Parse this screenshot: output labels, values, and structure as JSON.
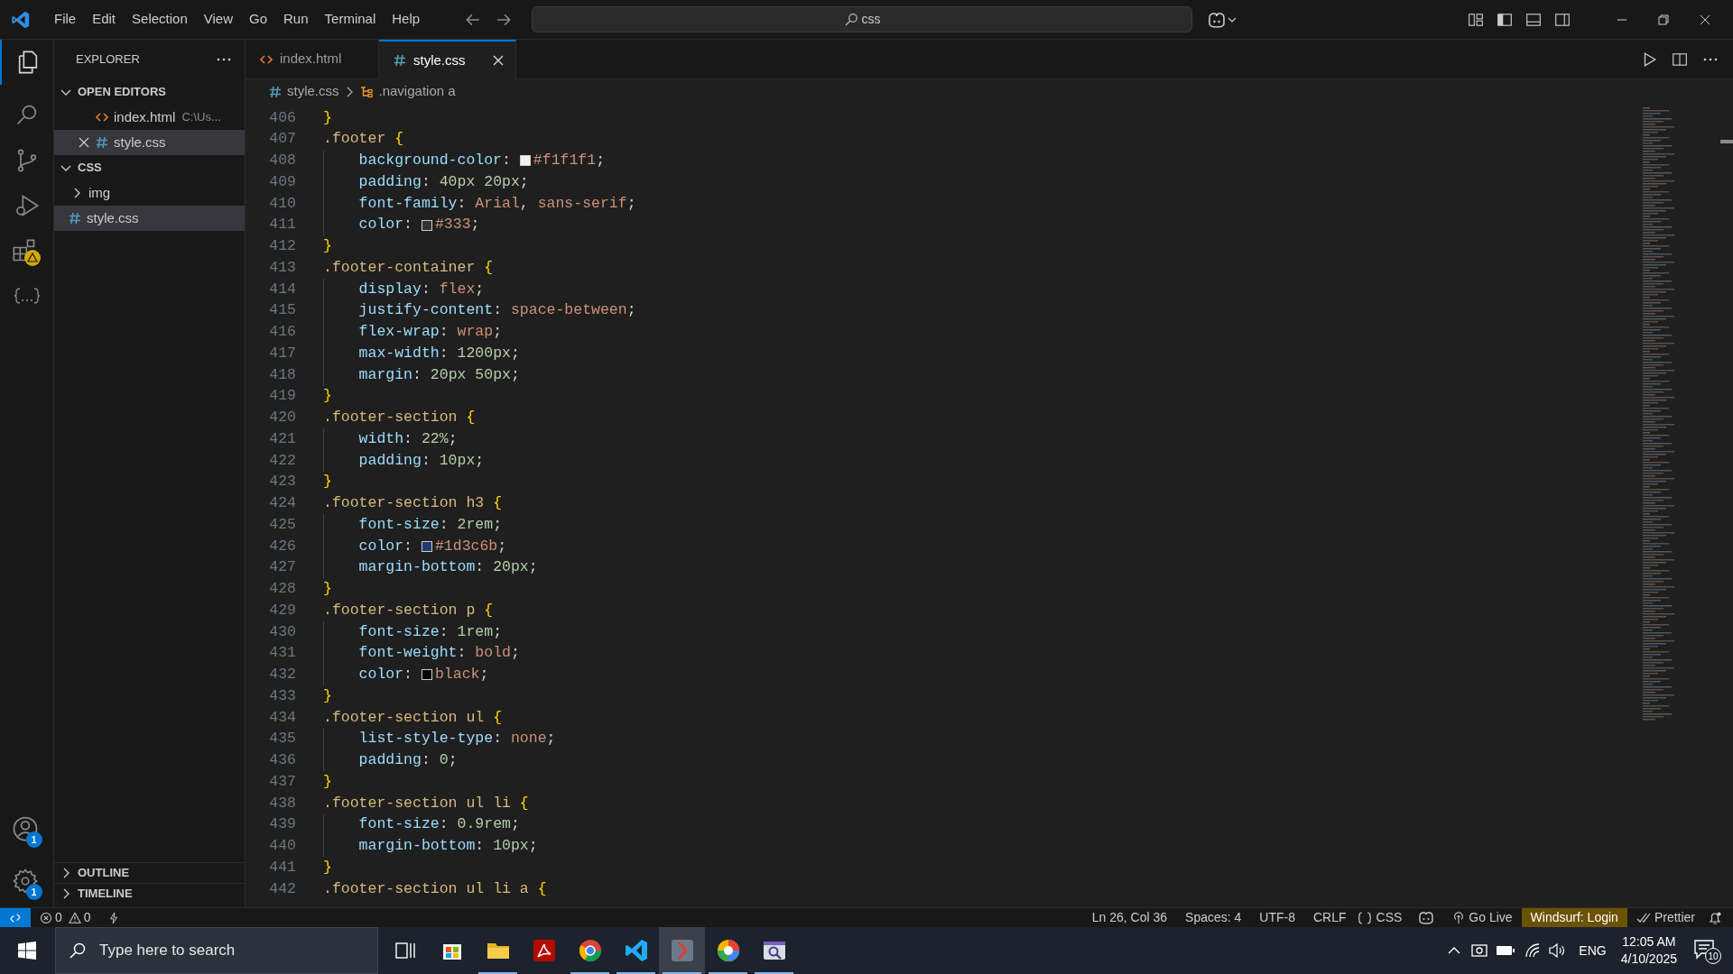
{
  "title_bar": {
    "menu": [
      "File",
      "Edit",
      "Selection",
      "View",
      "Go",
      "Run",
      "Terminal",
      "Help"
    ],
    "search": "css"
  },
  "activity_bar": {
    "account_badge": "1",
    "settings_badge": "1"
  },
  "sidebar": {
    "title": "EXPLORER",
    "sections": [
      {
        "label": "OPEN EDITORS",
        "expanded": true,
        "items": [
          {
            "kind": "html",
            "name": "index.html",
            "path": "C:\\Us...",
            "selected": false,
            "close": false
          },
          {
            "kind": "css",
            "name": "style.css",
            "selected": true,
            "close": true
          }
        ]
      },
      {
        "label": "CSS",
        "expanded": true,
        "items": [
          {
            "kind": "folder",
            "name": "img",
            "expanded": false,
            "selected": false
          },
          {
            "kind": "css",
            "name": "style.css",
            "selected": true
          }
        ]
      }
    ],
    "bottom_sections": [
      {
        "label": "OUTLINE",
        "expanded": false
      },
      {
        "label": "TIMELINE",
        "expanded": false
      }
    ]
  },
  "tabs": [
    {
      "kind": "html",
      "label": "index.html",
      "selected": false
    },
    {
      "kind": "css",
      "label": "style.css",
      "selected": true
    }
  ],
  "breadcrumb": [
    "style.css",
    ".navigation a"
  ],
  "code": {
    "lines": [
      {
        "number": "406",
        "indent": false,
        "tokens": [
          {
            "kind": "brace",
            "text": "}"
          }
        ]
      },
      {
        "number": "407",
        "indent": false,
        "tokens": [
          {
            "kind": "sel",
            "text": ".footer "
          },
          {
            "kind": "brace",
            "text": "{"
          }
        ]
      },
      {
        "number": "408",
        "indent": true,
        "tokens": [
          {
            "kind": "prop",
            "text": "background-color"
          },
          {
            "kind": "punct",
            "text": ": "
          },
          {
            "kind": "swatch",
            "color": "#f1f1f1"
          },
          {
            "kind": "val",
            "text": "#f1f1f1"
          },
          {
            "kind": "punct",
            "text": ";"
          }
        ]
      },
      {
        "number": "409",
        "indent": true,
        "tokens": [
          {
            "kind": "prop",
            "text": "padding"
          },
          {
            "kind": "punct",
            "text": ": "
          },
          {
            "kind": "num",
            "text": "40px 20px"
          },
          {
            "kind": "punct",
            "text": ";"
          }
        ]
      },
      {
        "number": "410",
        "indent": true,
        "tokens": [
          {
            "kind": "prop",
            "text": "font-family"
          },
          {
            "kind": "punct",
            "text": ": "
          },
          {
            "kind": "val",
            "text": "Arial"
          },
          {
            "kind": "punct",
            "text": ", "
          },
          {
            "kind": "val",
            "text": "sans-serif"
          },
          {
            "kind": "punct",
            "text": ";"
          }
        ]
      },
      {
        "number": "411",
        "indent": true,
        "tokens": [
          {
            "kind": "prop",
            "text": "color"
          },
          {
            "kind": "punct",
            "text": ": "
          },
          {
            "kind": "swatch",
            "color": "#333333"
          },
          {
            "kind": "val",
            "text": "#333"
          },
          {
            "kind": "punct",
            "text": ";"
          }
        ]
      },
      {
        "number": "412",
        "indent": false,
        "tokens": [
          {
            "kind": "brace",
            "text": "}"
          }
        ]
      },
      {
        "number": "413",
        "indent": false,
        "tokens": [
          {
            "kind": "sel",
            "text": ".footer-container "
          },
          {
            "kind": "brace",
            "text": "{"
          }
        ]
      },
      {
        "number": "414",
        "indent": true,
        "tokens": [
          {
            "kind": "prop",
            "text": "display"
          },
          {
            "kind": "punct",
            "text": ": "
          },
          {
            "kind": "val",
            "text": "flex"
          },
          {
            "kind": "punct",
            "text": ";"
          }
        ]
      },
      {
        "number": "415",
        "indent": true,
        "tokens": [
          {
            "kind": "prop",
            "text": "justify-content"
          },
          {
            "kind": "punct",
            "text": ": "
          },
          {
            "kind": "val",
            "text": "space-between"
          },
          {
            "kind": "punct",
            "text": ";"
          }
        ]
      },
      {
        "number": "416",
        "indent": true,
        "tokens": [
          {
            "kind": "prop",
            "text": "flex-wrap"
          },
          {
            "kind": "punct",
            "text": ": "
          },
          {
            "kind": "val",
            "text": "wrap"
          },
          {
            "kind": "punct",
            "text": ";"
          }
        ]
      },
      {
        "number": "417",
        "indent": true,
        "tokens": [
          {
            "kind": "prop",
            "text": "max-width"
          },
          {
            "kind": "punct",
            "text": ": "
          },
          {
            "kind": "num",
            "text": "1200"
          },
          {
            "kind": "num",
            "text": "px"
          },
          {
            "kind": "punct",
            "text": ";"
          }
        ]
      },
      {
        "number": "418",
        "indent": true,
        "tokens": [
          {
            "kind": "prop",
            "text": "margin"
          },
          {
            "kind": "punct",
            "text": ": "
          },
          {
            "kind": "num",
            "text": "20px 50px"
          },
          {
            "kind": "punct",
            "text": ";"
          }
        ]
      },
      {
        "number": "419",
        "indent": false,
        "tokens": [
          {
            "kind": "brace",
            "text": "}"
          }
        ]
      },
      {
        "number": "420",
        "indent": false,
        "tokens": [
          {
            "kind": "sel",
            "text": ".footer-section "
          },
          {
            "kind": "brace",
            "text": "{"
          }
        ]
      },
      {
        "number": "421",
        "indent": true,
        "tokens": [
          {
            "kind": "prop",
            "text": "width"
          },
          {
            "kind": "punct",
            "text": ": "
          },
          {
            "kind": "num",
            "text": "22%"
          },
          {
            "kind": "punct",
            "text": ";"
          }
        ]
      },
      {
        "number": "422",
        "indent": true,
        "tokens": [
          {
            "kind": "prop",
            "text": "padding"
          },
          {
            "kind": "punct",
            "text": ": "
          },
          {
            "kind": "num",
            "text": "10"
          },
          {
            "kind": "num",
            "text": "px"
          },
          {
            "kind": "punct",
            "text": ";"
          }
        ]
      },
      {
        "number": "423",
        "indent": false,
        "tokens": [
          {
            "kind": "brace",
            "text": "}"
          }
        ]
      },
      {
        "number": "424",
        "indent": false,
        "tokens": [
          {
            "kind": "sel",
            "text": ".footer-section h3 "
          },
          {
            "kind": "brace",
            "text": "{"
          }
        ]
      },
      {
        "number": "425",
        "indent": true,
        "tokens": [
          {
            "kind": "prop",
            "text": "font-size"
          },
          {
            "kind": "punct",
            "text": ": "
          },
          {
            "kind": "num",
            "text": "2"
          },
          {
            "kind": "num",
            "text": "rem"
          },
          {
            "kind": "punct",
            "text": ";"
          }
        ]
      },
      {
        "number": "426",
        "indent": true,
        "tokens": [
          {
            "kind": "prop",
            "text": "color"
          },
          {
            "kind": "punct",
            "text": ": "
          },
          {
            "kind": "swatch",
            "color": "#1d3c6b"
          },
          {
            "kind": "val",
            "text": "#1d3c6b"
          },
          {
            "kind": "punct",
            "text": ";"
          }
        ]
      },
      {
        "number": "427",
        "indent": true,
        "tokens": [
          {
            "kind": "prop",
            "text": "margin-bottom"
          },
          {
            "kind": "punct",
            "text": ": "
          },
          {
            "kind": "num",
            "text": "20"
          },
          {
            "kind": "num",
            "text": "px"
          },
          {
            "kind": "punct",
            "text": ";"
          }
        ]
      },
      {
        "number": "428",
        "indent": false,
        "tokens": [
          {
            "kind": "brace",
            "text": "}"
          }
        ]
      },
      {
        "number": "429",
        "indent": false,
        "tokens": [
          {
            "kind": "sel",
            "text": ".footer-section p "
          },
          {
            "kind": "brace",
            "text": "{"
          }
        ]
      },
      {
        "number": "430",
        "indent": true,
        "tokens": [
          {
            "kind": "prop",
            "text": "font-size"
          },
          {
            "kind": "punct",
            "text": ": "
          },
          {
            "kind": "num",
            "text": "1"
          },
          {
            "kind": "num",
            "text": "rem"
          },
          {
            "kind": "punct",
            "text": ";"
          }
        ]
      },
      {
        "number": "431",
        "indent": true,
        "tokens": [
          {
            "kind": "prop",
            "text": "font-weight"
          },
          {
            "kind": "punct",
            "text": ": "
          },
          {
            "kind": "val",
            "text": "bold"
          },
          {
            "kind": "punct",
            "text": ";"
          }
        ]
      },
      {
        "number": "432",
        "indent": true,
        "tokens": [
          {
            "kind": "prop",
            "text": "color"
          },
          {
            "kind": "punct",
            "text": ": "
          },
          {
            "kind": "swatch",
            "color": "#000000"
          },
          {
            "kind": "val",
            "text": "black"
          },
          {
            "kind": "punct",
            "text": ";"
          }
        ]
      },
      {
        "number": "433",
        "indent": false,
        "tokens": [
          {
            "kind": "brace",
            "text": "}"
          }
        ]
      },
      {
        "number": "434",
        "indent": false,
        "tokens": [
          {
            "kind": "sel",
            "text": ".footer-section ul "
          },
          {
            "kind": "brace",
            "text": "{"
          }
        ]
      },
      {
        "number": "435",
        "indent": true,
        "tokens": [
          {
            "kind": "prop",
            "text": "list-style-type"
          },
          {
            "kind": "punct",
            "text": ": "
          },
          {
            "kind": "val",
            "text": "none"
          },
          {
            "kind": "punct",
            "text": ";"
          }
        ]
      },
      {
        "number": "436",
        "indent": true,
        "tokens": [
          {
            "kind": "prop",
            "text": "padding"
          },
          {
            "kind": "punct",
            "text": ": "
          },
          {
            "kind": "num",
            "text": "0"
          },
          {
            "kind": "punct",
            "text": ";"
          }
        ]
      },
      {
        "number": "437",
        "indent": false,
        "tokens": [
          {
            "kind": "brace",
            "text": "}"
          }
        ]
      },
      {
        "number": "438",
        "indent": false,
        "tokens": [
          {
            "kind": "sel",
            "text": ".footer-section ul li "
          },
          {
            "kind": "brace",
            "text": "{"
          }
        ]
      },
      {
        "number": "439",
        "indent": true,
        "tokens": [
          {
            "kind": "prop",
            "text": "font-size"
          },
          {
            "kind": "punct",
            "text": ": "
          },
          {
            "kind": "num",
            "text": "0.9"
          },
          {
            "kind": "num",
            "text": "rem"
          },
          {
            "kind": "punct",
            "text": ";"
          }
        ]
      },
      {
        "number": "440",
        "indent": true,
        "tokens": [
          {
            "kind": "prop",
            "text": "margin-bottom"
          },
          {
            "kind": "punct",
            "text": ": "
          },
          {
            "kind": "num",
            "text": "10"
          },
          {
            "kind": "num",
            "text": "px"
          },
          {
            "kind": "punct",
            "text": ";"
          }
        ]
      },
      {
        "number": "441",
        "indent": false,
        "tokens": [
          {
            "kind": "brace",
            "text": "}"
          }
        ]
      },
      {
        "number": "442",
        "indent": false,
        "tokens": [
          {
            "kind": "sel",
            "text": ".footer-section ul li a "
          },
          {
            "kind": "brace",
            "text": "{"
          }
        ]
      }
    ]
  },
  "status_bar": {
    "errors": "0",
    "warnings": "0",
    "position": "Ln 26, Col 36",
    "spaces": "Spaces: 4",
    "encoding": "UTF-8",
    "eol": "CRLF",
    "language": "CSS",
    "go_live": "Go Live",
    "windsurf": "Windsurf: Login",
    "prettier": "Prettier"
  },
  "taskbar": {
    "search_placeholder": "Type here to search",
    "language": "ENG",
    "time": "12:05 AM",
    "date": "4/10/2025",
    "notifications": "10"
  }
}
